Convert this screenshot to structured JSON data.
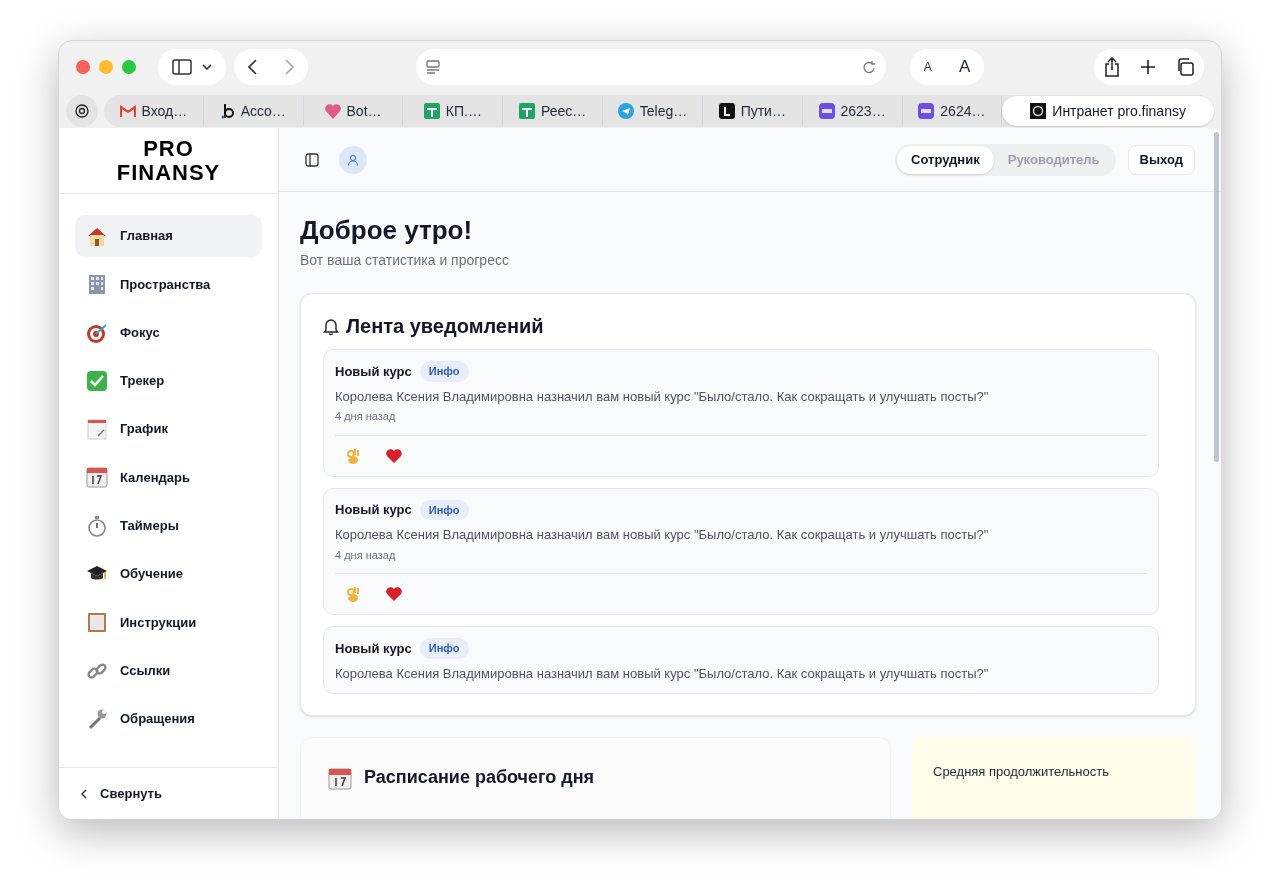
{
  "browser": {
    "tabs": [
      {
        "label": "Вход…",
        "selected": false
      },
      {
        "label": "Acco…",
        "selected": false
      },
      {
        "label": "Bot…",
        "selected": false
      },
      {
        "label": "КП.…",
        "selected": false
      },
      {
        "label": "Реес…",
        "selected": false
      },
      {
        "label": "Teleg…",
        "selected": false
      },
      {
        "label": "Пути…",
        "selected": false
      },
      {
        "label": "2623…",
        "selected": false
      },
      {
        "label": "2624…",
        "selected": false
      },
      {
        "label": "Интранет pro.finansy",
        "selected": true
      }
    ],
    "font_buttons": [
      "A",
      "A"
    ]
  },
  "sidebar": {
    "logo": [
      "PRO",
      "FINANSY"
    ],
    "items": [
      {
        "label": "Главная",
        "selected": true
      },
      {
        "label": "Пространства",
        "selected": false
      },
      {
        "label": "Фокус",
        "selected": false
      },
      {
        "label": "Трекер",
        "selected": false
      },
      {
        "label": "График",
        "selected": false
      },
      {
        "label": "Календарь",
        "selected": false
      },
      {
        "label": "Таймеры",
        "selected": false
      },
      {
        "label": "Обучение",
        "selected": false
      },
      {
        "label": "Инструкции",
        "selected": false
      },
      {
        "label": "Ссылки",
        "selected": false
      },
      {
        "label": "Обращения",
        "selected": false
      }
    ],
    "collapse": "Свернуть"
  },
  "header": {
    "roles": [
      {
        "label": "Сотрудник",
        "selected": true
      },
      {
        "label": "Руководитель",
        "selected": false
      }
    ],
    "logout": "Выход"
  },
  "greeting": {
    "title": "Доброе утро!",
    "subtitle": "Вот ваша статистика и прогресс"
  },
  "notifications": {
    "title": "Лента уведомлений",
    "items": [
      {
        "title": "Новый курс",
        "badge": "Инфо",
        "message": "Королева Ксения Владимировна назначил вам новый курс \"Было/стало. Как сокращать и улучшать посты?\"",
        "time": "4 дня назад",
        "reactions": true
      },
      {
        "title": "Новый курс",
        "badge": "Инфо",
        "message": "Королева Ксения Владимировна назначил вам новый курс \"Было/стало. Как сокращать и улучшать посты?\"",
        "time": "4 дня назад",
        "reactions": true
      },
      {
        "title": "Новый курс",
        "badge": "Инфо",
        "message": "Королева Ксения Владимировна назначил вам новый курс \"Было/стало. Как сокращать и улучшать посты?\"",
        "reactions": false
      }
    ]
  },
  "schedule": {
    "title": "Расписание рабочего дня"
  },
  "average": {
    "title": "Средняя продолжительность"
  }
}
